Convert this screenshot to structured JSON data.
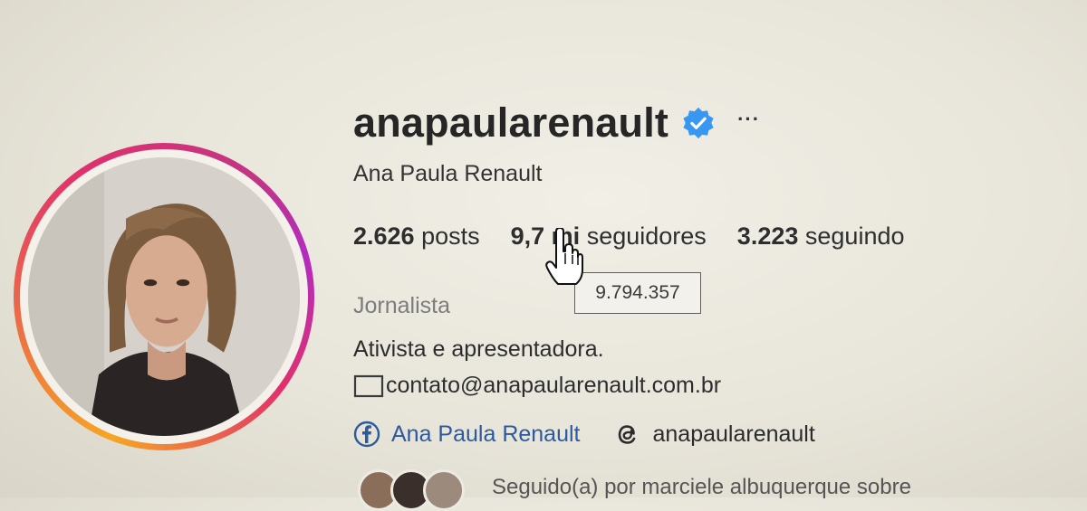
{
  "profile": {
    "username": "anapaularenault",
    "full_name": "Ana Paula Renault",
    "more_label": "···",
    "stats": {
      "posts_count": "2.626",
      "posts_label": "posts",
      "followers_count": "9,7 mi",
      "followers_label": "seguidores",
      "following_count": "3.223",
      "following_label": "seguindo"
    },
    "tooltip": "9.794.357",
    "category": "Jornalista",
    "bio": "Ativista e apresentadora.",
    "email": "contato@anapaularenault.com.br",
    "links": {
      "facebook": "Ana Paula Renault",
      "threads": "anapaularenault"
    },
    "followed_by": "Seguido(a) por marciele albuquerque sobre"
  },
  "icons": {
    "verified": "verified-badge-icon",
    "more": "more-options-icon",
    "mail": "mail-icon",
    "facebook": "facebook-icon",
    "threads": "threads-icon",
    "cursor": "hand-pointer-icon"
  },
  "colors": {
    "verified": "#3897f0",
    "link": "#2c5a9e",
    "ring_start": "#f5a623",
    "ring_mid": "#e1306c",
    "ring_end": "#b32cc0"
  }
}
